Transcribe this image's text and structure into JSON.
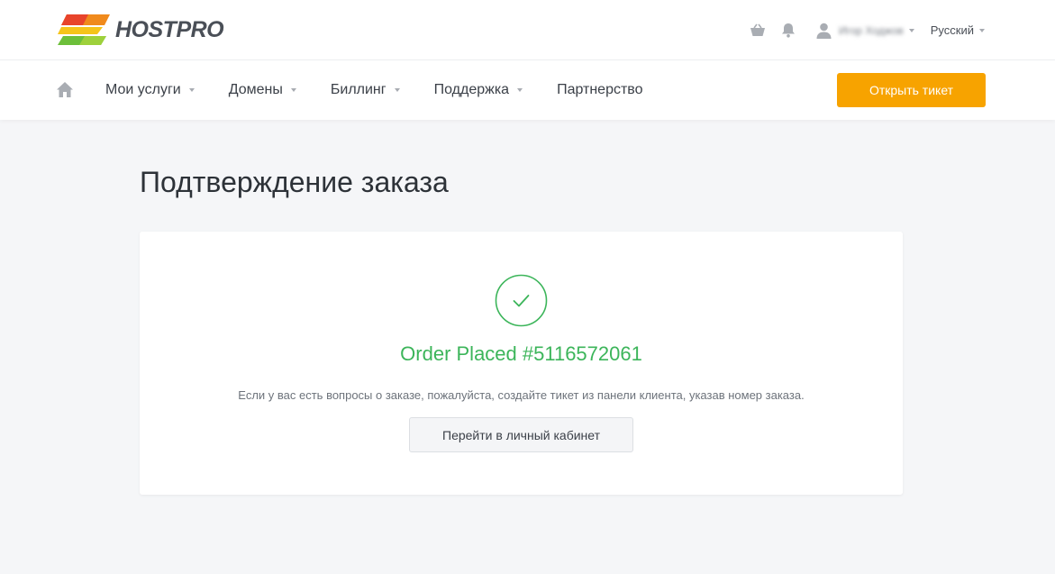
{
  "brand": {
    "name": "HOSTPRO",
    "accent": "#f7a300",
    "success": "#3cb55a"
  },
  "header": {
    "user_name": "Игор Ходжов",
    "language": "Русский",
    "icons": {
      "cart": "basket-icon",
      "notifications": "bell-icon",
      "user": "user-icon"
    }
  },
  "nav": {
    "items": [
      {
        "label": "Мои услуги",
        "has_dropdown": true
      },
      {
        "label": "Домены",
        "has_dropdown": true
      },
      {
        "label": "Биллинг",
        "has_dropdown": true
      },
      {
        "label": "Поддержка",
        "has_dropdown": true
      },
      {
        "label": "Партнерство",
        "has_dropdown": false
      }
    ],
    "ticket_button": "Открыть тикет"
  },
  "main": {
    "title": "Подтверждение заказа",
    "order_placed": "Order Placed #5116572061",
    "info": "Если у вас есть вопросы о заказе, пожалуйста, создайте тикет из панели клиента, указав номер заказа.",
    "cabinet_button": "Перейти в личный кабинет"
  }
}
